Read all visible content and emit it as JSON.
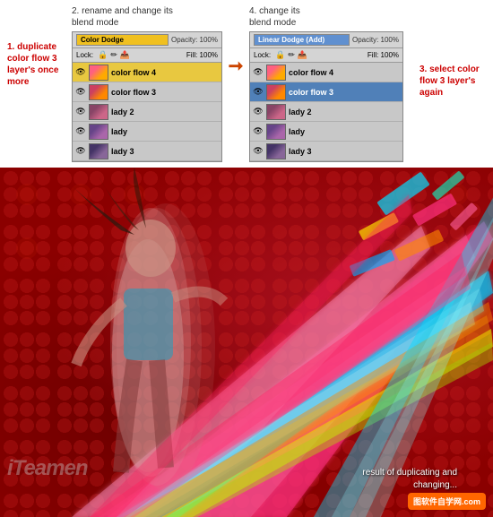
{
  "steps": {
    "step1": "1. duplicate\ncolor flow 3\nlayer's once\nmore",
    "step2_title": "2. rename and change its\nblend mode",
    "step3": "3. select color\nflow 3 layer's\nagain",
    "step4_title": "4. change its blend mode"
  },
  "left_panel": {
    "blend_mode": "Color Dodge",
    "opacity": "Opacity: 100%",
    "lock_label": "Lock:",
    "fill_label": "Fill: 100%",
    "layers": [
      {
        "name": "color flow 4",
        "selected": "yellow",
        "thumb": "cf4"
      },
      {
        "name": "color flow 3",
        "selected": "none",
        "thumb": "cf3"
      },
      {
        "name": "lady 2",
        "selected": "none",
        "thumb": "lady2"
      },
      {
        "name": "lady",
        "selected": "none",
        "thumb": "lady"
      },
      {
        "name": "lady 3",
        "selected": "none",
        "thumb": "lady3"
      }
    ]
  },
  "right_panel": {
    "blend_mode": "Linear Dodge (Add)",
    "opacity": "Opacity: 100%",
    "lock_label": "Lock:",
    "fill_label": "Fill: 100%",
    "layers": [
      {
        "name": "color flow 4",
        "selected": "none",
        "thumb": "cf4"
      },
      {
        "name": "color flow 3",
        "selected": "blue",
        "thumb": "cf3"
      },
      {
        "name": "lady 2",
        "selected": "none",
        "thumb": "lady2"
      },
      {
        "name": "lady",
        "selected": "none",
        "thumb": "lady"
      },
      {
        "name": "lady 3",
        "selected": "none",
        "thumb": "lady3"
      }
    ]
  },
  "result_text": "result of duplicating and\nchanging...",
  "watermark": "iTeamen",
  "site_badge": "图软件自学网.com"
}
